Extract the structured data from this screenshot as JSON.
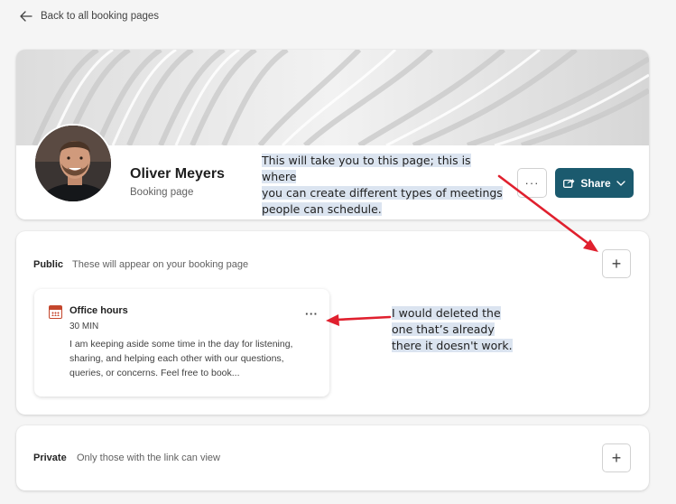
{
  "nav": {
    "back_label": "Back to all booking pages"
  },
  "profile": {
    "name": "Oliver Meyers",
    "subtitle": "Booking page"
  },
  "actions": {
    "more_label": "···",
    "share_label": "Share"
  },
  "public_section": {
    "label": "Public",
    "description": "These will appear on your booking page",
    "add_label": "+"
  },
  "meeting": {
    "title": "Office hours",
    "duration": "30 MIN",
    "description": "I am keeping aside some time in the day for listening, sharing, and helping each other with our questions, queries, or concerns. Feel free to book...",
    "more_label": "···"
  },
  "private_section": {
    "label": "Private",
    "description": "Only those with the link can view",
    "add_label": "+"
  },
  "annotations": {
    "note1_line1": "This will take you to this page; this is where",
    "note1_line2": "you can create different types of meetings",
    "note1_line3": "people can schedule.",
    "note2_line1": " I would deleted the",
    "note2_line2": "one that’s already",
    "note2_line3": "there it doesn't work."
  },
  "colors": {
    "accent": "#1b5a6e",
    "annotation_arrow": "#e0202e",
    "annotation_highlight": "#dbe4f0",
    "calendar_icon": "#c4462c"
  }
}
